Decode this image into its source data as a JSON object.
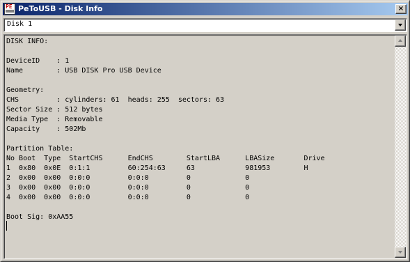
{
  "window": {
    "title": "PeToUSB - Disk Info",
    "icon": "petousb-app-icon",
    "icon_glyph": "PE",
    "close_glyph": "×"
  },
  "disk_selector": {
    "selected": "Disk 1"
  },
  "report": {
    "lines": [
      "DISK INFO:",
      "",
      "DeviceID    : 1",
      "Name        : USB DISK Pro USB Device",
      "",
      "Geometry:",
      "CHS         : cylinders: 61  heads: 255  sectors: 63",
      "Sector Size : 512 bytes",
      "Media Type  : Removable",
      "Capacity    : 502Mb",
      "",
      "Partition Table:",
      "No Boot  Type  StartCHS      EndCHS        StartLBA      LBASize       Drive",
      "1  0x80  0x0E  0:1:1         60:254:63     63            981953        H",
      "2  0x00  0x00  0:0:0         0:0:0         0             0",
      "3  0x00  0x00  0:0:0         0:0:0         0             0",
      "4  0x00  0x00  0:0:0         0:0:0         0             0",
      "",
      "Boot Sig: 0xAA55"
    ]
  },
  "colors": {
    "title_gradient_start": "#0a246a",
    "title_gradient_end": "#a6caf0",
    "face": "#d4d0c8"
  }
}
